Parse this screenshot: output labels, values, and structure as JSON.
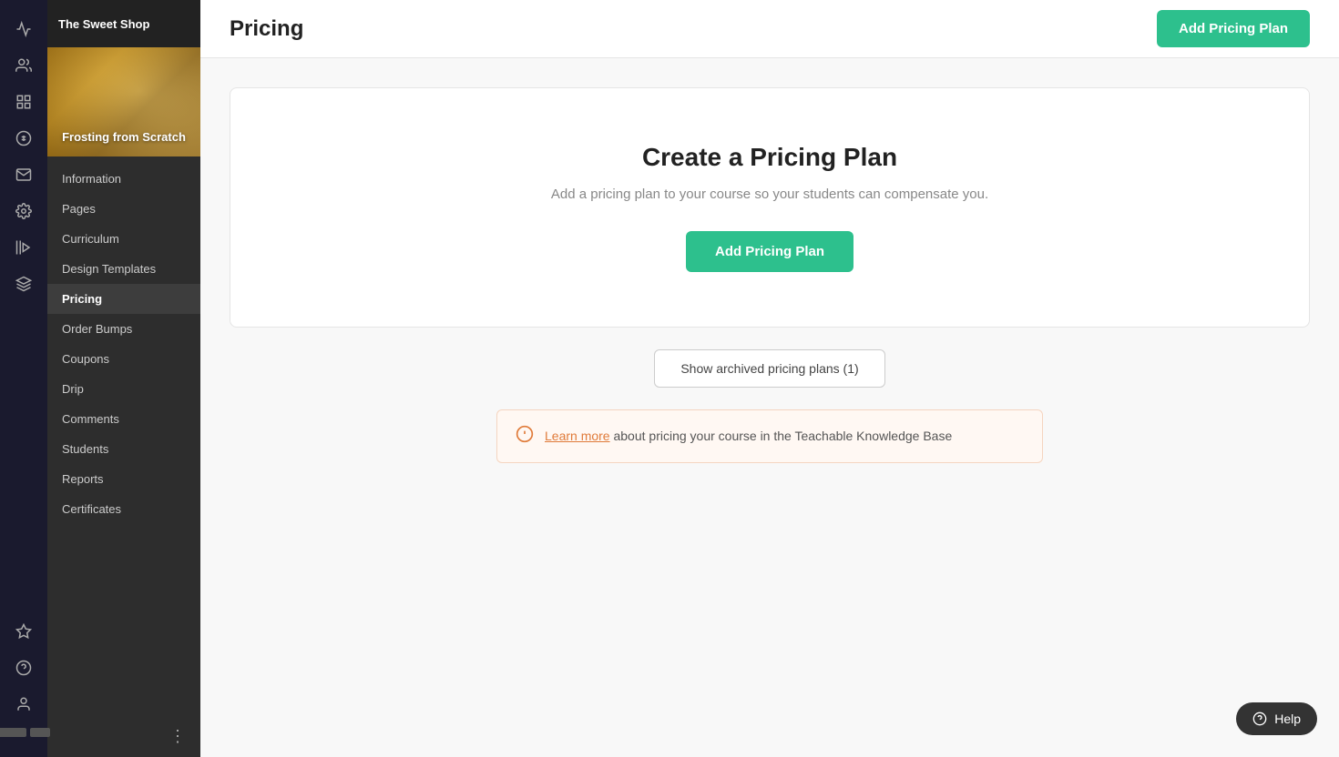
{
  "app": {
    "title": "The Sweet Shop"
  },
  "course": {
    "name": "Frosting from Scratch"
  },
  "left_sidebar": {
    "icons": [
      {
        "name": "analytics-icon",
        "symbol": "📈"
      },
      {
        "name": "users-icon",
        "symbol": "👥"
      },
      {
        "name": "dashboard-icon",
        "symbol": "⊞"
      },
      {
        "name": "dollar-icon",
        "symbol": "💲"
      },
      {
        "name": "mail-icon",
        "symbol": "✉"
      },
      {
        "name": "settings-icon",
        "symbol": "⚙"
      },
      {
        "name": "library-icon",
        "symbol": "▌▌▌"
      },
      {
        "name": "chart-icon",
        "symbol": "⛬"
      },
      {
        "name": "star-icon",
        "symbol": "☆"
      },
      {
        "name": "question-icon",
        "symbol": "?"
      },
      {
        "name": "team-icon",
        "symbol": "👤"
      }
    ]
  },
  "course_nav": {
    "items": [
      {
        "label": "Information",
        "active": false
      },
      {
        "label": "Pages",
        "active": false
      },
      {
        "label": "Curriculum",
        "active": false
      },
      {
        "label": "Design Templates",
        "active": false
      },
      {
        "label": "Pricing",
        "active": true
      },
      {
        "label": "Order Bumps",
        "active": false
      },
      {
        "label": "Coupons",
        "active": false
      },
      {
        "label": "Drip",
        "active": false
      },
      {
        "label": "Comments",
        "active": false
      },
      {
        "label": "Students",
        "active": false
      },
      {
        "label": "Reports",
        "active": false
      },
      {
        "label": "Certificates",
        "active": false
      }
    ]
  },
  "page": {
    "title": "Pricing"
  },
  "header_button": {
    "label": "Add Pricing Plan"
  },
  "empty_state": {
    "title": "Create a Pricing Plan",
    "subtitle": "Add a pricing plan to your course so your students can compensate you.",
    "button_label": "Add Pricing Plan"
  },
  "archived_button": {
    "label": "Show archived pricing plans (1)"
  },
  "info_banner": {
    "link_text": "Learn more",
    "text": " about pricing your course in the Teachable Knowledge Base"
  },
  "help_button": {
    "label": "Help"
  }
}
